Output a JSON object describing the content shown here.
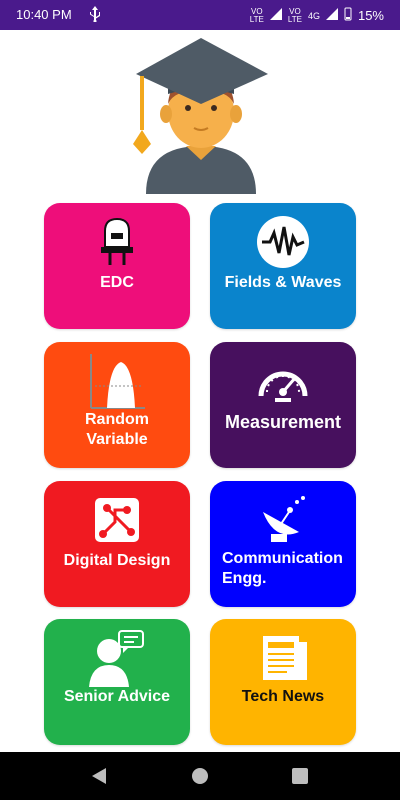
{
  "status_bar": {
    "time": "10:40 PM",
    "battery": "15%",
    "network": "4G",
    "volte1": "VO",
    "volte1_sub": "LTE",
    "volte2": "VO",
    "volte2_sub": "LTE"
  },
  "tiles": [
    {
      "label": "EDC",
      "color": "#ee0e7a",
      "icon": "diode-icon"
    },
    {
      "label": "Fields & Waves",
      "color": "#0a84cc",
      "icon": "waveform-icon"
    },
    {
      "label": "Random Variable",
      "color": "#ff4b10",
      "icon": "bell-curve-icon"
    },
    {
      "label": "Measurement",
      "color": "#47105e",
      "icon": "speedometer-icon"
    },
    {
      "label": "Digital Design",
      "color": "#f01a21",
      "icon": "circuit-icon"
    },
    {
      "label": "Communication Engg.",
      "color": "#0000ff",
      "icon": "satellite-dish-icon"
    },
    {
      "label": "Senior Advice",
      "color": "#22b14c",
      "icon": "advisor-chat-icon"
    },
    {
      "label": "Tech News",
      "color": "#ffb400",
      "icon": "newspaper-icon"
    }
  ]
}
